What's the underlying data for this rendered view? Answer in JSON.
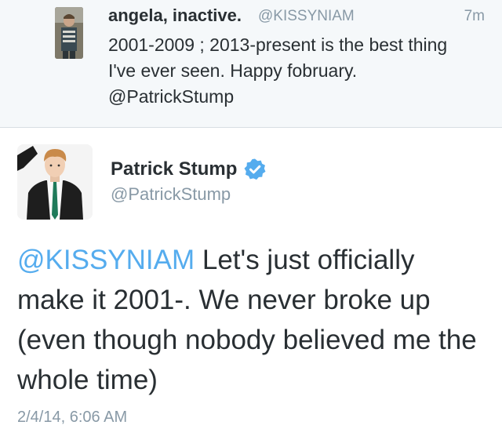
{
  "reply_tweet": {
    "display_name": "angela, inactive.",
    "handle": "@KISSYNIAM",
    "time": "7m",
    "text_before": "2001-2009 ; 2013-present is the best thing I've ever seen. Happy fobruary.",
    "mention": "@PatrickStump"
  },
  "main_tweet": {
    "display_name": "Patrick Stump",
    "handle": "@PatrickStump",
    "verified": true,
    "mention": "@KISSYNIAM",
    "text": "Let's just officially make it 2001-. We never broke up (even though nobody believed me the whole time)",
    "timestamp": "2/4/14, 6:06 AM"
  },
  "colors": {
    "link_blue": "#55acee",
    "muted_gray": "#8899a6",
    "text_dark": "#292f33",
    "reply_background": "#f5f8fa"
  },
  "icons": {
    "verified": "verified-badge-icon"
  }
}
